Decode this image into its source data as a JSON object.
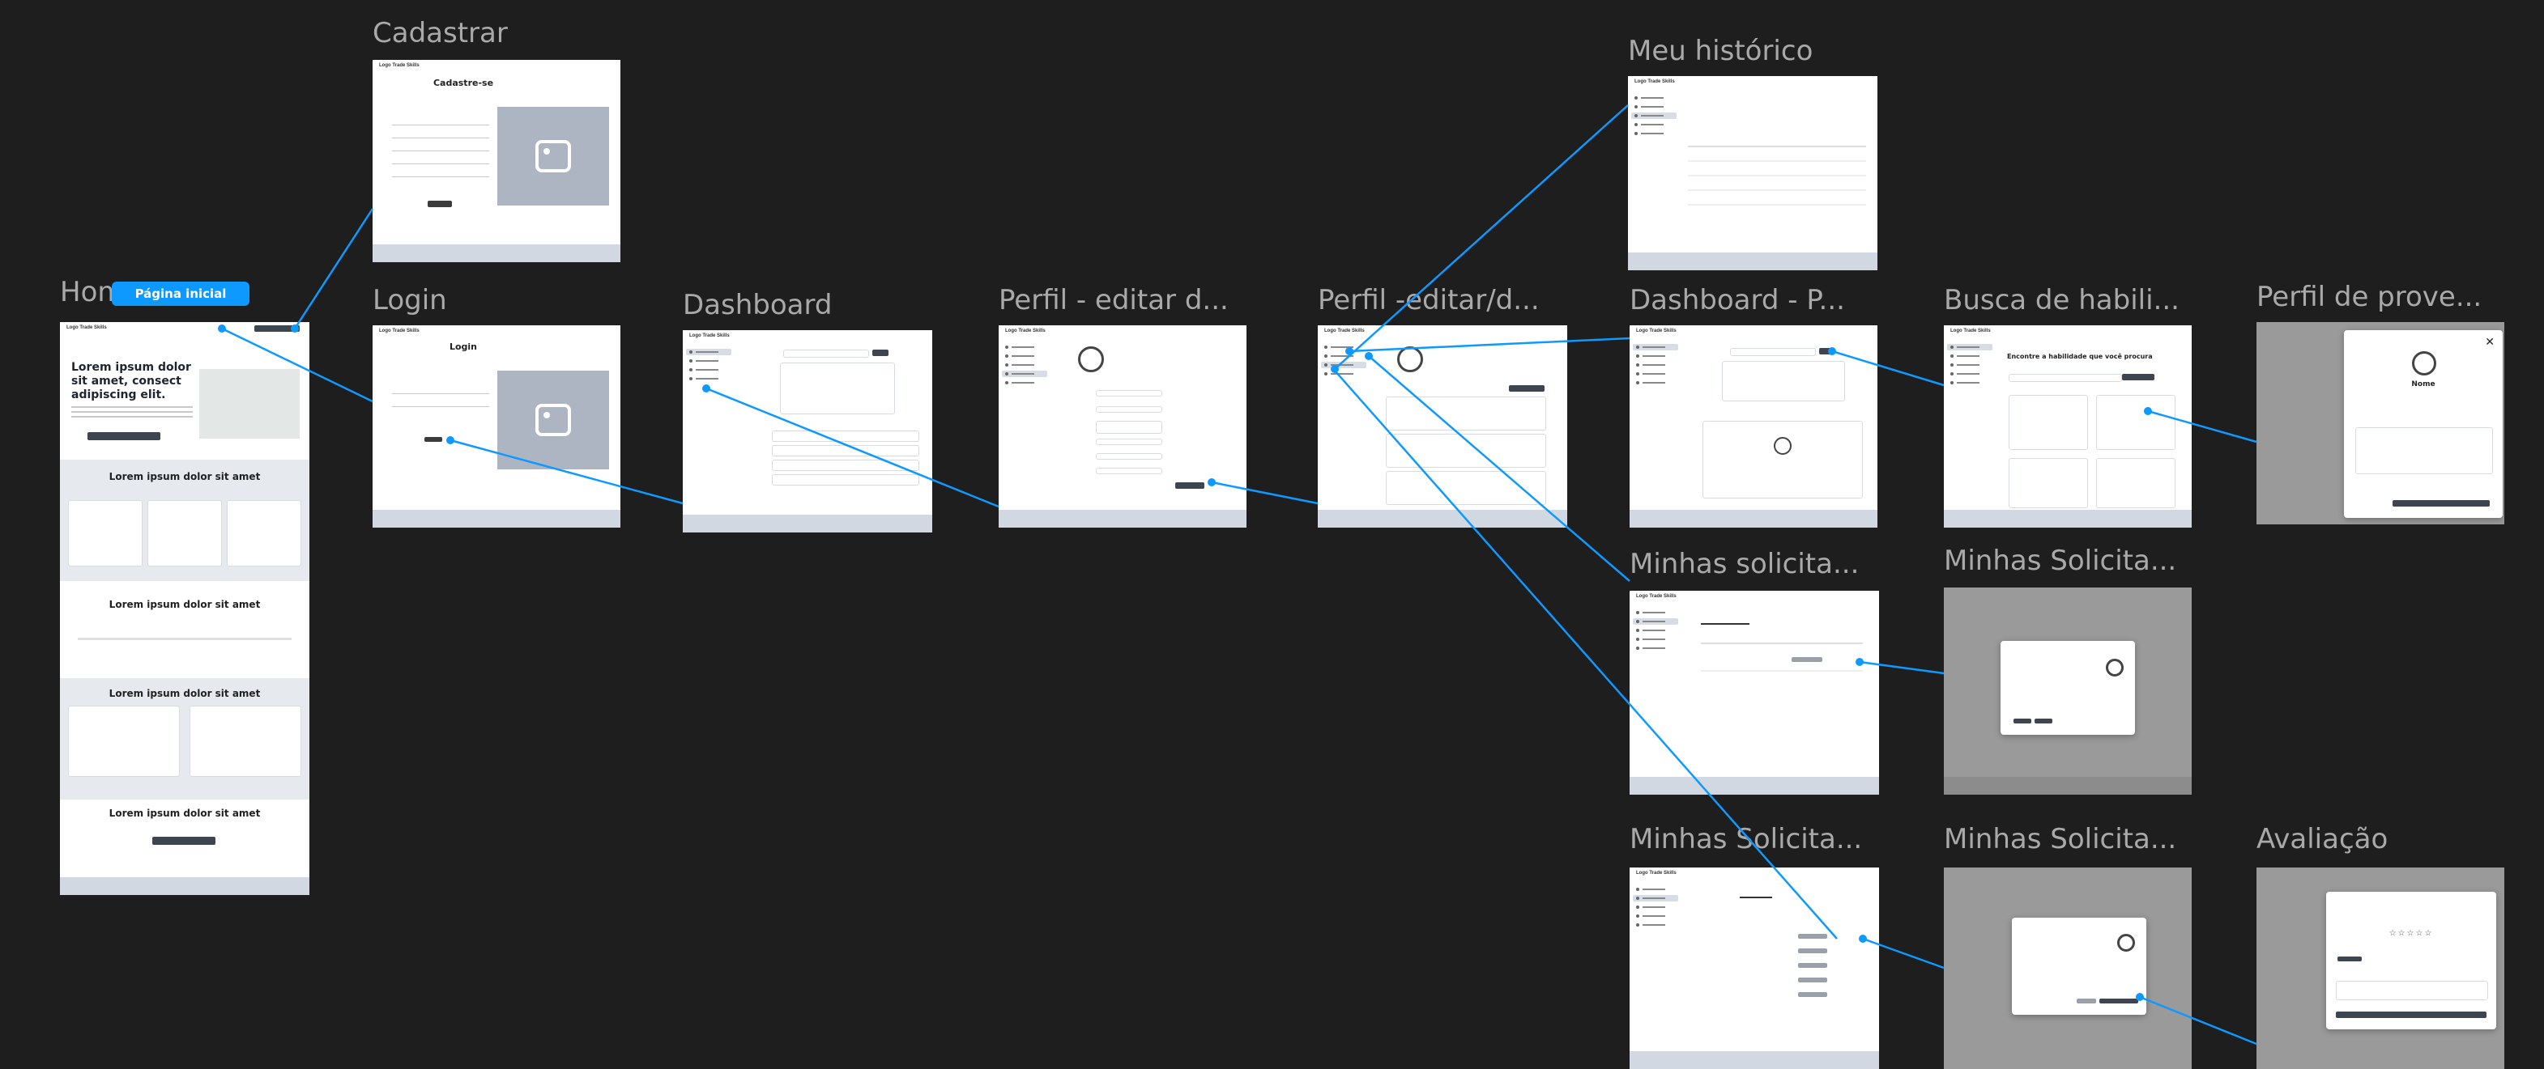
{
  "frames": {
    "home": {
      "label": "Home",
      "tag": "Página inicial"
    },
    "cadastrar": {
      "label": "Cadastrar",
      "title": "Cadastre-se"
    },
    "login": {
      "label": "Login",
      "title": "Login"
    },
    "dashboard": {
      "label": "Dashboard"
    },
    "perfil_editar": {
      "label": "Perfil - editar d..."
    },
    "perfil_editar2": {
      "label": "Perfil -editar/d..."
    },
    "meu_historico": {
      "label": "Meu histórico"
    },
    "dashboard_p": {
      "label": "Dashboard - P..."
    },
    "busca": {
      "label": "Busca de habili...",
      "heading": "Encontre a habilidade que você procura"
    },
    "perfil_prove": {
      "label": "Perfil de prove...",
      "name": "Nome"
    },
    "minhas_sol1": {
      "label": "Minhas solicita..."
    },
    "minhas_sol2": {
      "label": "Minhas Solicita..."
    },
    "minhas_sol3": {
      "label": "Minhas Solicita..."
    },
    "minhas_sol4": {
      "label": "Minhas Solicita..."
    },
    "avaliacao": {
      "label": "Avaliação"
    }
  },
  "home_content": {
    "hero_title": "Lorem ipsum dolor sit amet, consect adipiscing elit.",
    "section_title_1": "Lorem ipsum dolor sit amet",
    "section_title_2": "Lorem ipsum dolor sit amet",
    "section_title_3": "Lorem ipsum dolor sit amet",
    "section_title_4": "Lorem ipsum dolor sit amet"
  },
  "colors": {
    "canvas": "#1e1e1e",
    "accent": "#0d99ff",
    "label": "#a9a9a9"
  }
}
